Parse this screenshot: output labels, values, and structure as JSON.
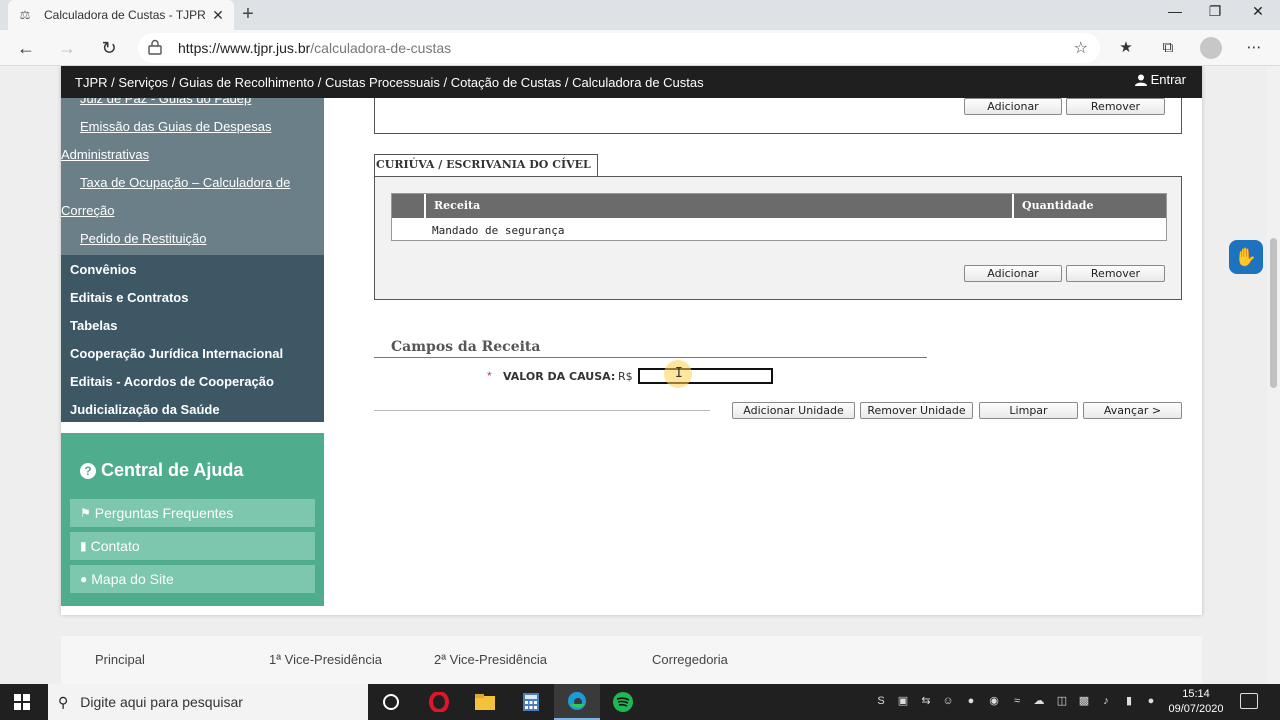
{
  "browser": {
    "tab_title": "Calculadora de Custas - TJPR",
    "url_host": "https://www.tjpr.jus.br",
    "url_path": "/calculadora-de-custas"
  },
  "topbar": {
    "breadcrumb": "TJPR / Serviços / Guias de Recolhimento / Custas Processuais / Cotação de Custas / Calculadora de Custas",
    "login": "Entrar"
  },
  "sidebar": {
    "links": [
      "Juiz de Paz - Guias do Fadep",
      "Emissão das Guias de Despesas",
      "Administrativas",
      "Taxa de Ocupação – Calculadora de",
      "Correção",
      "Pedido de Restituição"
    ],
    "items": [
      "Convênios",
      "Editais e Contratos",
      "Tabelas",
      "Cooperação Jurídica Internacional",
      "Editais - Acordos de Cooperação",
      "Judicialização da Saúde"
    ]
  },
  "help": {
    "title": "Central de Ajuda",
    "buttons": [
      "Perguntas Frequentes",
      "Contato",
      "Mapa do Site"
    ]
  },
  "top_fieldset": {
    "add_label": "Adicionar",
    "remove_label": "Remover"
  },
  "curiuva": {
    "legend": "CURIÚVA / ESCRIVANIA DO CÍVEL",
    "columns": [
      "Receita",
      "Quantidade"
    ],
    "rows": [
      {
        "receita": "Mandado de segurança",
        "quantidade": ""
      }
    ],
    "add_label": "Adicionar",
    "remove_label": "Remover"
  },
  "campos": {
    "title": "Campos da Receita",
    "required_mark": "*",
    "valor_label": "VALOR DA CAUSA:",
    "currency": "R$",
    "valor_value": ""
  },
  "actions": {
    "add_unit": "Adicionar Unidade",
    "remove_unit": "Remover Unidade",
    "clear": "Limpar",
    "next": "Avançar >"
  },
  "footer": {
    "links": [
      "Principal",
      "1ª Vice-Presidência",
      "2ª Vice-Presidência",
      "Corregedoria"
    ]
  },
  "taskbar": {
    "search_placeholder": "Digite aqui para pesquisar",
    "time": "15:14",
    "date": "09/07/2020"
  }
}
